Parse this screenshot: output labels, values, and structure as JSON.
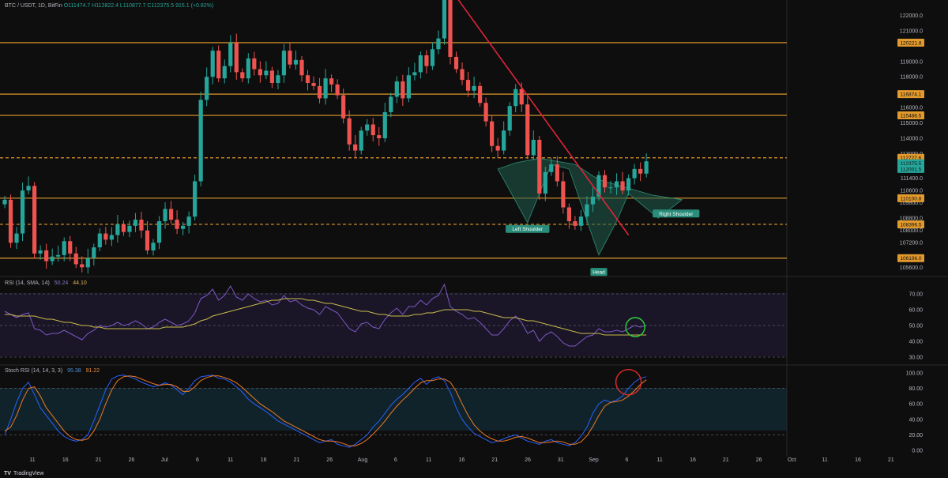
{
  "header": {
    "symbol": "BTC / USDT, 1D, BitFin",
    "ohlc": "O111474.7 H112822.4 L110877.7 C112375.5 915.1 (+0.82%)"
  },
  "rsi_header": {
    "label": "RSI (14, SMA, 14)",
    "rsi_value": "50.24",
    "sma_value": "44.10"
  },
  "stoch_header": {
    "label": "Stoch RSI (14, 14, 3, 3)",
    "k_value": "95.38",
    "d_value": "91.22"
  },
  "brand": "TradingView",
  "colors": {
    "up": "#26a69a",
    "down": "#ef5350",
    "level": "#e29a2d",
    "trend": "#e8243a",
    "rsi": "#7e57c2",
    "rsi_ma": "#c9b94a",
    "stoch_k": "#2962ff",
    "stoch_d": "#ef7a26",
    "pattern_fill": "#1f5c4d",
    "circle_rsi": "#2fcf3c",
    "circle_stoch": "#e22a2a"
  },
  "chart_data": [
    {
      "type": "candlestick",
      "title": "BTC / USDT, 1D, BitFin",
      "ylim": [
        105000,
        123000
      ],
      "y_ticks": [
        122000,
        121000,
        119000,
        118000,
        116000,
        115000,
        114000,
        113000,
        111400,
        110600,
        109800,
        108800,
        108000,
        107200,
        105600
      ],
      "x_ticks": [
        "11",
        "16",
        "21",
        "26",
        "Jul",
        "6",
        "11",
        "16",
        "21",
        "26",
        "Aug",
        "6",
        "11",
        "16",
        "21",
        "26",
        "31",
        "Sep",
        "6",
        "11",
        "16",
        "21",
        "26",
        "Oct",
        "11",
        "16",
        "21"
      ],
      "closes": [
        110000,
        107200,
        107800,
        110600,
        110900,
        106500,
        106700,
        106000,
        106300,
        106400,
        107300,
        106500,
        105800,
        105600,
        106200,
        106900,
        107800,
        107400,
        107700,
        108400,
        107900,
        108300,
        108700,
        108000,
        106700,
        107200,
        108600,
        109400,
        108700,
        108100,
        108300,
        108900,
        111200,
        116500,
        118000,
        119700,
        117900,
        118700,
        120200,
        118300,
        117900,
        119200,
        118500,
        118100,
        118400,
        117600,
        118100,
        119700,
        118800,
        119100,
        118100,
        117600,
        117400,
        116600,
        117900,
        117500,
        116800,
        115300,
        113600,
        113200,
        114500,
        114900,
        114200,
        114000,
        115700,
        116700,
        117700,
        116600,
        118100,
        118300,
        119400,
        118700,
        119800,
        120500,
        123500,
        119300,
        118500,
        117800,
        117100,
        117400,
        116300,
        115100,
        113500,
        113200,
        114500,
        116100,
        117200,
        116200,
        112900,
        113900,
        110400,
        111800,
        112300,
        111200,
        109500,
        108600,
        108300,
        108900,
        109700,
        110200,
        111600,
        110800,
        110800,
        111200,
        110600,
        111400,
        112000,
        111700,
        112500
      ],
      "labeled_levels": [
        120221.8,
        116874.1,
        115488.5,
        112727.6,
        112375.5,
        112001.5,
        110100.8,
        108396.5,
        106196.0
      ],
      "dashed_levels": [
        112727.6,
        108396.5
      ],
      "annotations": [
        "Left Shoulder",
        "Head",
        "Right Shoulder"
      ]
    },
    {
      "type": "line",
      "title": "RSI (14, SMA, 14)",
      "ylim": [
        25,
        80
      ],
      "y_ticks": [
        70.0,
        60.0,
        50.0,
        40.0,
        30.0
      ],
      "series": [
        {
          "name": "RSI",
          "values": [
            59,
            57,
            55,
            57,
            58,
            48,
            47,
            44,
            45,
            45,
            47,
            45,
            43,
            41,
            45,
            47,
            50,
            49,
            50,
            52,
            50,
            51,
            53,
            51,
            48,
            49,
            52,
            54,
            52,
            50,
            51,
            53,
            58,
            67,
            69,
            73,
            66,
            69,
            75,
            68,
            66,
            70,
            67,
            65,
            66,
            63,
            64,
            69,
            65,
            66,
            63,
            61,
            60,
            57,
            62,
            60,
            58,
            53,
            48,
            46,
            51,
            52,
            49,
            48,
            54,
            58,
            61,
            57,
            62,
            62,
            66,
            63,
            67,
            69,
            76,
            62,
            59,
            57,
            54,
            55,
            52,
            48,
            44,
            44,
            48,
            53,
            56,
            52,
            45,
            47,
            40,
            44,
            46,
            43,
            39,
            37,
            37,
            40,
            43,
            44,
            48,
            46,
            46,
            47,
            46,
            48,
            50,
            49,
            50
          ]
        },
        {
          "name": "SMA",
          "values": [
            57,
            57,
            56,
            56,
            56,
            56,
            55,
            54,
            54,
            53,
            52,
            52,
            51,
            50,
            50,
            49,
            49,
            48,
            48,
            48,
            48,
            48,
            48,
            48,
            48,
            48,
            48,
            49,
            49,
            49,
            49,
            50,
            51,
            53,
            54,
            56,
            57,
            58,
            59,
            60,
            61,
            62,
            63,
            64,
            65,
            66,
            66,
            67,
            67,
            67,
            67,
            66,
            66,
            65,
            64,
            64,
            63,
            62,
            61,
            60,
            59,
            59,
            58,
            57,
            57,
            56,
            56,
            56,
            56,
            57,
            57,
            58,
            58,
            59,
            60,
            60,
            60,
            60,
            60,
            59,
            59,
            58,
            57,
            56,
            55,
            55,
            55,
            54,
            53,
            53,
            52,
            51,
            50,
            49,
            48,
            47,
            46,
            45,
            45,
            45,
            45,
            44,
            44,
            44,
            44,
            44,
            44,
            44,
            44
          ]
        }
      ]
    },
    {
      "type": "line",
      "title": "Stoch RSI (14, 14, 3, 3)",
      "ylim": [
        -8,
        108
      ],
      "y_ticks": [
        100.0,
        80.0,
        60.0,
        40.0,
        20.0,
        0.0
      ],
      "series": [
        {
          "name": "K",
          "values": [
            20,
            40,
            62,
            80,
            88,
            72,
            55,
            45,
            35,
            25,
            18,
            14,
            12,
            14,
            20,
            38,
            58,
            78,
            92,
            96,
            97,
            95,
            92,
            88,
            85,
            82,
            84,
            87,
            84,
            78,
            72,
            80,
            90,
            95,
            96,
            97,
            93,
            92,
            88,
            82,
            75,
            66,
            60,
            55,
            50,
            44,
            38,
            34,
            30,
            26,
            22,
            18,
            14,
            10,
            12,
            14,
            8,
            6,
            4,
            8,
            14,
            20,
            30,
            38,
            48,
            58,
            66,
            72,
            80,
            88,
            93,
            85,
            92,
            95,
            90,
            75,
            55,
            40,
            30,
            22,
            18,
            14,
            10,
            12,
            15,
            18,
            20,
            16,
            12,
            10,
            8,
            12,
            14,
            10,
            8,
            6,
            10,
            18,
            30,
            48,
            60,
            65,
            62,
            65,
            70,
            80,
            88,
            93,
            95
          ]
        },
        {
          "name": "D",
          "values": [
            25,
            30,
            45,
            65,
            80,
            82,
            70,
            55,
            45,
            35,
            25,
            18,
            14,
            13,
            15,
            25,
            40,
            60,
            78,
            90,
            95,
            96,
            95,
            92,
            89,
            86,
            84,
            85,
            85,
            82,
            76,
            76,
            82,
            90,
            94,
            96,
            96,
            94,
            91,
            87,
            81,
            74,
            67,
            60,
            55,
            50,
            44,
            38,
            34,
            30,
            26,
            22,
            18,
            14,
            12,
            12,
            11,
            9,
            6,
            6,
            9,
            14,
            21,
            29,
            38,
            48,
            57,
            65,
            72,
            80,
            87,
            90,
            90,
            92,
            92,
            88,
            76,
            60,
            45,
            33,
            25,
            19,
            15,
            12,
            12,
            14,
            17,
            18,
            16,
            13,
            10,
            10,
            11,
            12,
            11,
            8,
            8,
            11,
            19,
            31,
            45,
            57,
            62,
            63,
            65,
            70,
            77,
            85,
            91
          ]
        }
      ]
    }
  ]
}
